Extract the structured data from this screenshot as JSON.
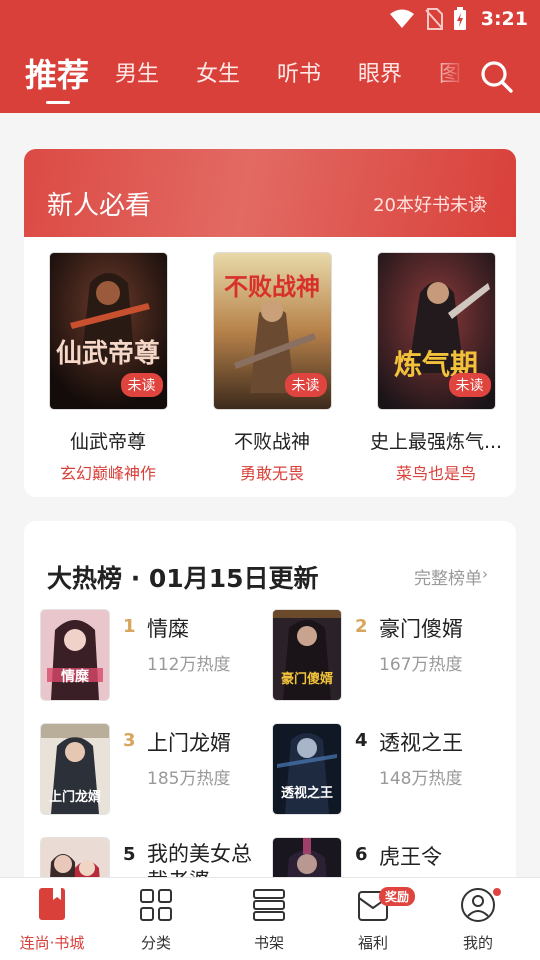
{
  "status_bar": {
    "time": "3:21"
  },
  "nav": {
    "tabs": [
      {
        "label": "推荐",
        "active": true
      },
      {
        "label": "男生"
      },
      {
        "label": "女生"
      },
      {
        "label": "听书"
      },
      {
        "label": "眼界"
      },
      {
        "label": "图"
      }
    ],
    "search_icon": "search-icon"
  },
  "newbie": {
    "title": "新人必看",
    "more_label": "20本好书未读",
    "books": [
      {
        "name": "仙武帝尊",
        "tag": "玄幻巅峰神作",
        "badge": "未读",
        "cover_text": "仙武帝尊"
      },
      {
        "name": "不败战神",
        "tag": "勇敢无畏",
        "badge": "未读",
        "cover_text": "不败战神"
      },
      {
        "name": "史上最强炼气...",
        "tag": "菜鸟也是鸟",
        "badge": "未读",
        "cover_text": "炼气期"
      }
    ]
  },
  "hot": {
    "title": "大热榜 · 01月15日更新",
    "more_label": "完整榜单",
    "items": [
      {
        "rank": "1",
        "name": "情糜",
        "heat": "112万热度",
        "cover_text": "情糜"
      },
      {
        "rank": "2",
        "name": "豪门傻婿",
        "heat": "167万热度",
        "cover_text": "豪门傻婿"
      },
      {
        "rank": "3",
        "name": "上门龙婿",
        "heat": "185万热度",
        "cover_text": "上门龙婿"
      },
      {
        "rank": "4",
        "name": "透视之王",
        "heat": "148万热度",
        "cover_text": "透视之王"
      },
      {
        "rank": "5",
        "name": "我的美女总裁老婆",
        "heat": "",
        "cover_text": ""
      },
      {
        "rank": "6",
        "name": "虎王令",
        "heat": "",
        "cover_text": ""
      }
    ]
  },
  "bottom_nav": [
    {
      "label": "连尚·书城",
      "icon": "bookstore-icon",
      "active": true
    },
    {
      "label": "分类",
      "icon": "category-grid-icon"
    },
    {
      "label": "书架",
      "icon": "bookshelf-icon"
    },
    {
      "label": "福利",
      "icon": "welfare-envelope-icon",
      "badge": "奖励"
    },
    {
      "label": "我的",
      "icon": "profile-icon"
    }
  ],
  "colors": {
    "brand": "#d9403a",
    "rank_top3": "#d9a45b",
    "rank_other": "#222222"
  }
}
